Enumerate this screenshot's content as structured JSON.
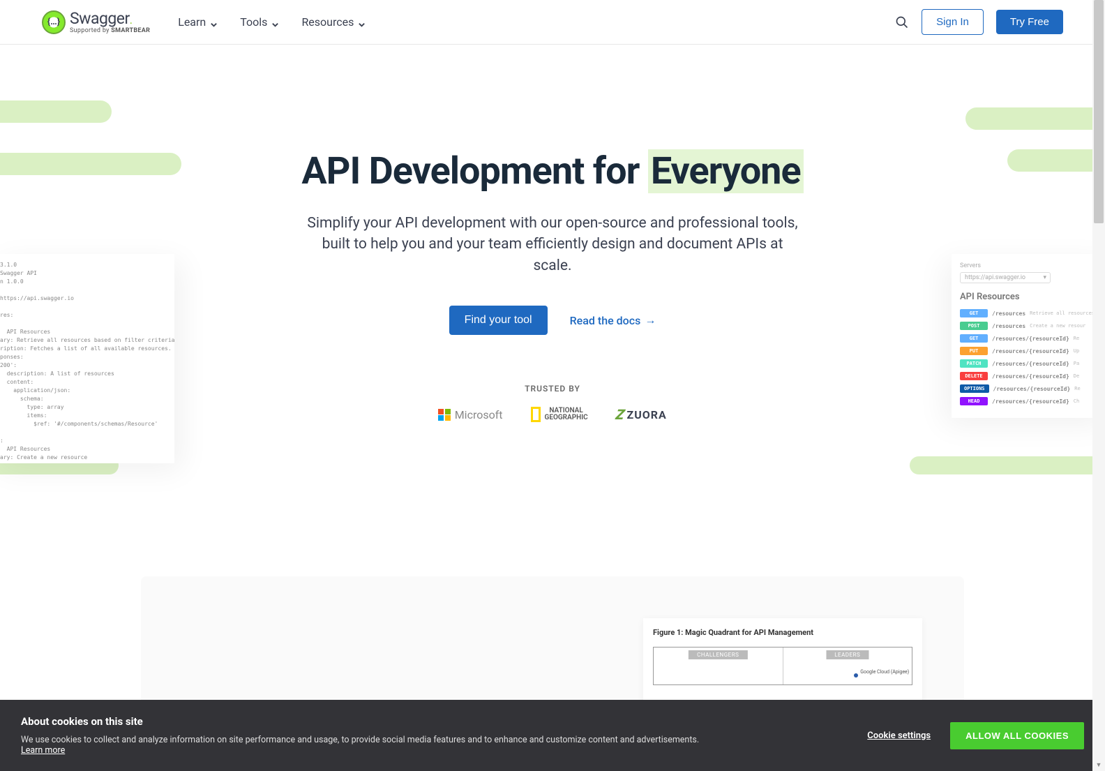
{
  "nav": {
    "learn": "Learn",
    "tools": "Tools",
    "resources": "Resources"
  },
  "logo": {
    "name": "Swagger",
    "dot": ".",
    "supported_prefix": "Supported by ",
    "supported_brand": "SMARTBEAR",
    "braces": "{…}"
  },
  "header": {
    "signin": "Sign In",
    "tryfree": "Try Free"
  },
  "hero": {
    "title_pre": "API Development for",
    "title_hl": "Everyone",
    "subtitle": "Simplify your API development with our open-source and professional tools, built to help you and your team efficiently design and document APIs at scale.",
    "cta_find": "Find your tool",
    "cta_docs": "Read the docs",
    "cta_arrow": "→"
  },
  "trusted": {
    "label": "TRUSTED BY",
    "microsoft": "Microsoft",
    "natgeo_1": "NATIONAL",
    "natgeo_2": "GEOGRAPHIC",
    "zuora": "ZUORA"
  },
  "float_api": {
    "servers_label": "Servers",
    "server_url": "https://api.swagger.io",
    "heading": "API Resources",
    "rows": [
      {
        "method": "GET",
        "cls": "m-get",
        "path": "/resources",
        "desc": "Retrieve all resources"
      },
      {
        "method": "POST",
        "cls": "m-post",
        "path": "/resources",
        "desc": "Create a new resour"
      },
      {
        "method": "GET",
        "cls": "m-get",
        "path": "/resources/{resourceId}",
        "desc": "Re"
      },
      {
        "method": "PUT",
        "cls": "m-put",
        "path": "/resources/{resourceId}",
        "desc": "Up"
      },
      {
        "method": "PATCH",
        "cls": "m-patch",
        "path": "/resources/{resourceId}",
        "desc": "Pa"
      },
      {
        "method": "DELETE",
        "cls": "m-delete",
        "path": "/resources/{resourceId}",
        "desc": "De"
      },
      {
        "method": "OPTIONS",
        "cls": "m-options",
        "path": "/resources/{resourceId}",
        "desc": "Re"
      },
      {
        "method": "HEAD",
        "cls": "m-head",
        "path": "/resources/{resourceId}",
        "desc": "Ch"
      }
    ]
  },
  "float_code": {
    "lines": "3.1.0\nSwagger API\nn 1.0.0\n\nhttps://api.swagger.io\n\nres:\n\n  API Resources\nary: Retrieve all resources based on filter criteria\nription: Fetches a list of all available resources.\nponses:\n200':\n  description: A list of resources\n  content:\n    application/json:\n      schema:\n        type: array\n        items:\n          $ref: '#/components/schemas/Resource'\n\n:\n  API Resources\nary: Create a new resource\nription: Creates a new resource with the provided data.\nuestBody:\nequired: true\nontent:\n  application/json:\n    schema:\n      $ref: '#/components/schemas/Resource'"
  },
  "section2": {
    "chart_title": "Figure 1: Magic Quadrant for API Management",
    "q_challengers": "CHALLENGERS",
    "q_leaders": "LEADERS",
    "dot_label": "Google Cloud (Apigee)"
  },
  "cookies": {
    "title": "About cookies on this site",
    "text": "We use cookies to collect and analyze information on site performance and usage, to provide social media features and to enhance and customize content and advertisements. ",
    "learn": "Learn more",
    "settings": "Cookie settings",
    "allow": "ALLOW ALL COOKIES"
  }
}
